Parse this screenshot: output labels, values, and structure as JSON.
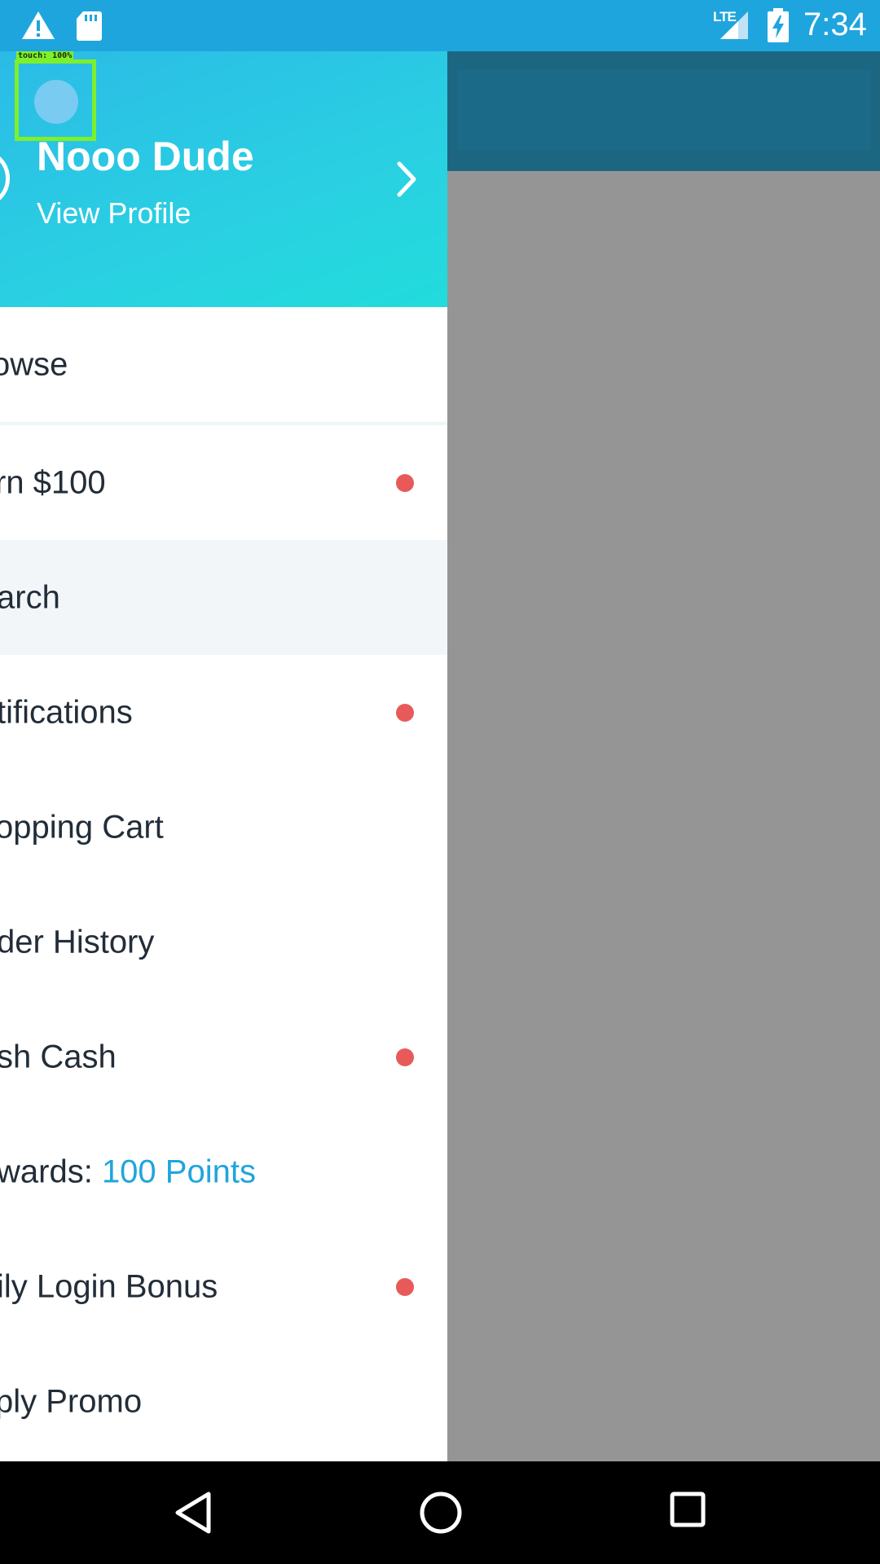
{
  "status_bar": {
    "time": "7:34",
    "network": "LTE",
    "icons": [
      "warning-icon",
      "sd-card-icon",
      "lte-signal-icon",
      "battery-charging-icon"
    ]
  },
  "drawer": {
    "user_name": "Nooo Dude",
    "view_profile": "View Profile",
    "touch_overlay": "touch: 100%",
    "items": [
      {
        "label": "owse",
        "dot": false
      },
      {
        "label": "rn $100",
        "dot": true
      },
      {
        "label": "arch",
        "dot": false,
        "highlighted": true
      },
      {
        "label": "tifications",
        "dot": true
      },
      {
        "label": "opping Cart",
        "dot": false
      },
      {
        "label": "der History",
        "dot": false
      },
      {
        "label": "sh Cash",
        "dot": true
      },
      {
        "label": "wards: ",
        "value": "100 Points",
        "dot": false
      },
      {
        "label": "ily Login Bonus",
        "dot": true
      },
      {
        "label": "ply Promo",
        "dot": false
      }
    ]
  },
  "colors": {
    "status_bar": "#1fa5dd",
    "header_gradient_start": "#2bbbe6",
    "header_gradient_end": "#21dcdc",
    "dot": "#e85a5a",
    "points": "#1fa5dd",
    "scrim": "#959595"
  },
  "nav_bar": {
    "icons": [
      "back-icon",
      "home-icon",
      "recents-icon"
    ]
  }
}
